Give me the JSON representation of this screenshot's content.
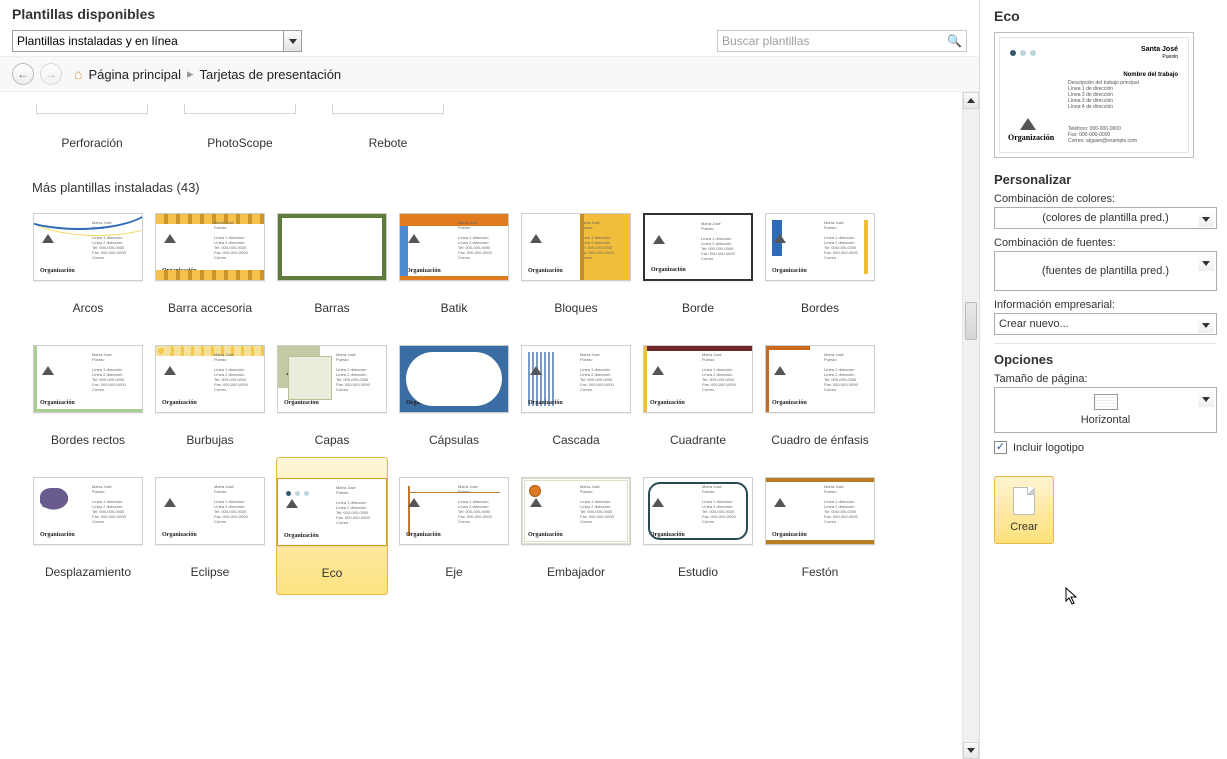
{
  "header": {
    "title": "Plantillas disponibles"
  },
  "filter": {
    "value": "Plantillas instaladas y en línea"
  },
  "search": {
    "placeholder": "Buscar plantillas"
  },
  "breadcrumb": {
    "home": "Página principal",
    "current": "Tarjetas de presentación"
  },
  "top_row": {
    "items": [
      {
        "label": "Perforación"
      },
      {
        "label": "PhotoScope"
      },
      {
        "label": "Rebote"
      }
    ]
  },
  "section": {
    "title": "Más plantillas instaladas (43)"
  },
  "templates_row1": [
    {
      "label": "Arcos",
      "cls": "th-arcos"
    },
    {
      "label": "Barra accesoria",
      "cls": "th-barra"
    },
    {
      "label": "Barras",
      "cls": "th-barras"
    },
    {
      "label": "Batik",
      "cls": "th-batik"
    },
    {
      "label": "Bloques",
      "cls": "th-bloques"
    },
    {
      "label": "Borde",
      "cls": "th-borde"
    },
    {
      "label": "Bordes",
      "cls": "th-bordes"
    }
  ],
  "templates_row2": [
    {
      "label": "Bordes rectos",
      "cls": "th-bordesrectos"
    },
    {
      "label": "Burbujas",
      "cls": "th-burbujas"
    },
    {
      "label": "Capas",
      "cls": "th-capas"
    },
    {
      "label": "Cápsulas",
      "cls": "th-capsulas"
    },
    {
      "label": "Cascada",
      "cls": "th-cascada"
    },
    {
      "label": "Cuadrante",
      "cls": "th-cuadrante"
    },
    {
      "label": "Cuadro de énfasis",
      "cls": "th-cuadroenf"
    }
  ],
  "templates_row3": [
    {
      "label": "Desplazamiento",
      "cls": "th-desplaz"
    },
    {
      "label": "Eclipse",
      "cls": "th-eclipse"
    },
    {
      "label": "Eco",
      "cls": "th-eco",
      "selected": true
    },
    {
      "label": "Eje",
      "cls": "th-eje"
    },
    {
      "label": "Embajador",
      "cls": "th-embajador"
    },
    {
      "label": "Estudio",
      "cls": "th-estudio"
    },
    {
      "label": "Festón",
      "cls": "th-feston"
    }
  ],
  "right_panel": {
    "title": "Eco",
    "preview": {
      "name_line": "Santa José",
      "role_line": "Puesto",
      "job_title": "Nombre del trabajo",
      "desc": "Descripción del trabajo principal",
      "l1": "Línea 1 de dirección",
      "l2": "Línea 2 de dirección",
      "l3": "Línea 3 de dirección",
      "l4": "Línea 4 de dirección",
      "tel": "Teléfono: 000-000-0000",
      "fax": "Fax: 000-000-0000",
      "mail": "Correo: alguien@example.com",
      "org": "Organización"
    },
    "personalize_head": "Personalizar",
    "color_label": "Combinación de colores:",
    "color_value": "(colores de plantilla pred.)",
    "font_label": "Combinación de fuentes:",
    "font_value": "(fuentes de plantilla pred.)",
    "biz_label": "Información empresarial:",
    "biz_value": "Crear nuevo...",
    "options_head": "Opciones",
    "pagesize_label": "Tamaño de página:",
    "pagesize_value": "Horizontal",
    "include_logo": "Incluir logotipo",
    "create_label": "Crear"
  }
}
